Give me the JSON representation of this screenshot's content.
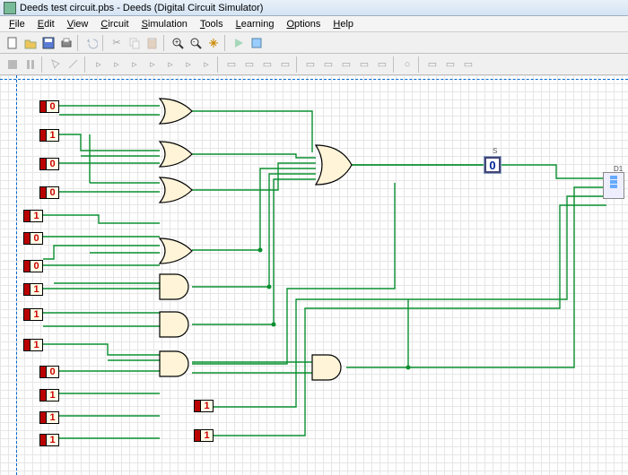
{
  "window": {
    "title": "Deeds test circuit.pbs - Deeds (Digital Circuit Simulator)"
  },
  "menu": {
    "file": "File",
    "edit": "Edit",
    "view": "View",
    "circuit": "Circuit",
    "simulation": "Simulation",
    "tools": "Tools",
    "learning": "Learning",
    "options": "Options",
    "help": "Help"
  },
  "inputs": {
    "i0": "0",
    "i1": "1",
    "i2": "0",
    "i3": "0",
    "i4": "1",
    "i5": "0",
    "i6": "0",
    "i7": "1",
    "i8": "1",
    "i9": "1",
    "i10": "0",
    "i11": "1",
    "i12": "1",
    "i13": "1",
    "i14": "1",
    "i15": "1"
  },
  "outputs": {
    "s": "0"
  },
  "labels": {
    "out_s": "S",
    "out_d": "D1"
  },
  "colors": {
    "wire": "#0a9030",
    "gate_fill": "#fff4d8",
    "gate_stroke": "#000"
  }
}
